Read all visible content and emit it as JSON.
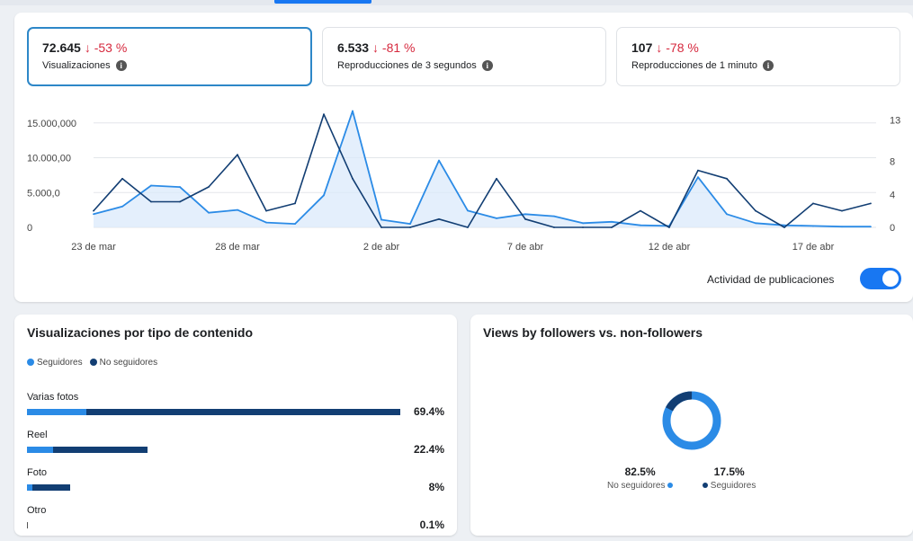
{
  "metrics": [
    {
      "value": "72.645",
      "change": "↓ -53 %",
      "label": "Visualizaciones"
    },
    {
      "value": "6.533",
      "change": "↓ -81 %",
      "label": "Reproducciones de 3 segundos"
    },
    {
      "value": "107",
      "change": "↓ -78 %",
      "label": "Reproducciones de 1 minuto"
    }
  ],
  "toggle": {
    "label": "Actividad de publicaciones",
    "on": true
  },
  "chart_data": {
    "type": "line",
    "x": [
      "23 mar",
      "24 mar",
      "25 mar",
      "26 mar",
      "27 mar",
      "28 mar",
      "29 mar",
      "30 mar",
      "31 mar",
      "1 abr",
      "2 abr",
      "3 abr",
      "4 abr",
      "5 abr",
      "6 abr",
      "7 abr",
      "8 abr",
      "9 abr",
      "10 abr",
      "11 abr",
      "12 abr",
      "13 abr",
      "14 abr",
      "15 abr",
      "16 abr",
      "17 abr",
      "18 abr",
      "19 abr"
    ],
    "x_tick_labels": [
      "23 de mar",
      "28 de mar",
      "2 de abr",
      "7 de abr",
      "12 de abr",
      "17 de abr"
    ],
    "y_left_ticks": [
      "0",
      "5.000,0",
      "10.000,00",
      "15.000,000"
    ],
    "y_right_ticks": [
      "0",
      "4",
      "8",
      "13"
    ],
    "ylim_left": [
      0,
      16000
    ],
    "ylim_right": [
      0,
      13.5
    ],
    "grid": true,
    "series": [
      {
        "axis": "left",
        "color": "#2b8be6",
        "fill": true,
        "values": [
          1900,
          3000,
          6000,
          5800,
          2100,
          2500,
          700,
          500,
          4600,
          16700,
          1100,
          500,
          9600,
          2400,
          1300,
          1900,
          1600,
          600,
          800,
          300,
          200,
          7200,
          1900,
          600,
          300,
          200,
          100,
          100
        ]
      },
      {
        "axis": "right",
        "color": "#123e73",
        "fill": false,
        "values": [
          2,
          5.9,
          3.1,
          3.1,
          4.9,
          8.8,
          2,
          2.9,
          13.7,
          5.9,
          0,
          0,
          1,
          0,
          5.9,
          1,
          0,
          0,
          0,
          2,
          0,
          6.9,
          5.9,
          2,
          0,
          2.9,
          2,
          2.9
        ]
      }
    ]
  },
  "content_type": {
    "title": "Visualizaciones por tipo de contenido",
    "legend": [
      {
        "label": "Seguidores",
        "color": "#2b8be6"
      },
      {
        "label": "No seguidores",
        "color": "#123e73"
      }
    ],
    "rows": [
      {
        "label": "Varias fotos",
        "pct": "69.4%",
        "value": 69.4,
        "followers_share": 0.16
      },
      {
        "label": "Reel",
        "pct": "22.4%",
        "value": 22.4,
        "followers_share": 0.22
      },
      {
        "label": "Foto",
        "pct": "8%",
        "value": 8,
        "followers_share": 0.12
      },
      {
        "label": "Otro",
        "pct": "0.1%",
        "value": 0.1,
        "followers_share": 0.0
      }
    ]
  },
  "followers_split": {
    "title": "Views by followers vs. non-followers",
    "items": [
      {
        "value": "82.5%",
        "label": "No seguidores",
        "color": "#2b8be6",
        "share": 82.5
      },
      {
        "value": "17.5%",
        "label": "Seguidores",
        "color": "#123e73",
        "share": 17.5
      }
    ]
  }
}
